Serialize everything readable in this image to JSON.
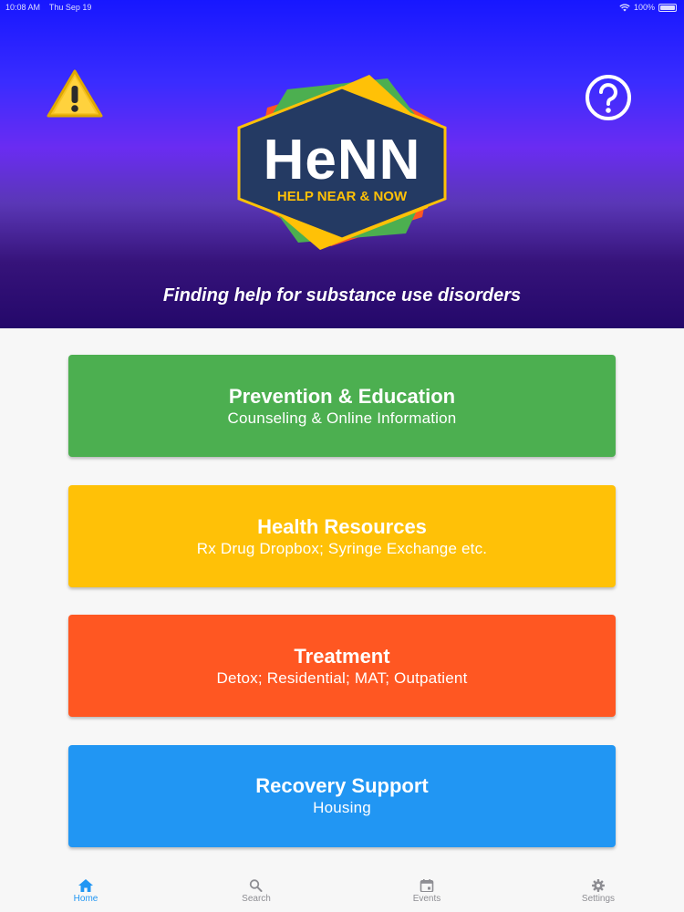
{
  "status_bar": {
    "time": "10:08 AM",
    "date": "Thu Sep 19",
    "battery": "100%"
  },
  "header": {
    "logo_text": "HeNN",
    "logo_subtitle": "HELP NEAR & NOW",
    "tagline": "Finding help for substance use disorders"
  },
  "cards": [
    {
      "title": "Prevention & Education",
      "subtitle": "Counseling & Online Information",
      "color": "#4caf50"
    },
    {
      "title": "Health Resources",
      "subtitle": "Rx Drug Dropbox; Syringe Exchange etc.",
      "color": "#ffc107"
    },
    {
      "title": "Treatment",
      "subtitle": "Detox; Residential; MAT; Outpatient",
      "color": "#ff5722"
    },
    {
      "title": "Recovery Support",
      "subtitle": "Housing",
      "color": "#2196f3"
    }
  ],
  "tabs": [
    {
      "label": "Home",
      "icon": "home-icon",
      "active": true
    },
    {
      "label": "Search",
      "icon": "search-icon",
      "active": false
    },
    {
      "label": "Events",
      "icon": "calendar-icon",
      "active": false
    },
    {
      "label": "Settings",
      "icon": "gear-icon",
      "active": false
    }
  ],
  "colors": {
    "accent": "#2196f3",
    "inactive_tab": "#8e8e93",
    "warning": "#f7c325"
  }
}
